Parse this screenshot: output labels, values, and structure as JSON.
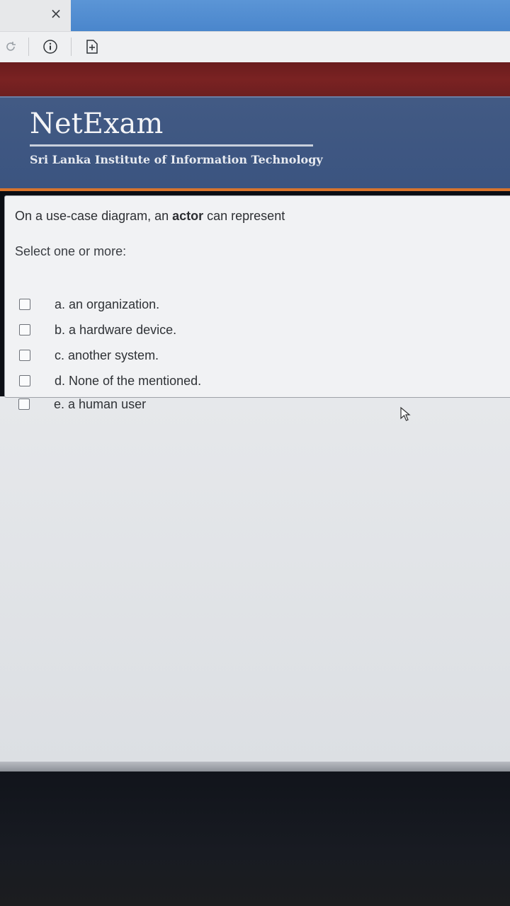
{
  "browser": {
    "close_tab_symbol": "×",
    "toolbar_icons": [
      "reload-icon",
      "info-icon",
      "add-page-icon"
    ]
  },
  "header": {
    "logo_title": "NetExam",
    "institute": "Sri Lanka Institute of Information Technology"
  },
  "question": {
    "text_before": "On a use-case diagram, an ",
    "text_bold": "actor",
    "text_after": " can represent",
    "prompt": "Select one or more:",
    "options": [
      {
        "label": "a. an organization.",
        "checked": false
      },
      {
        "label": "b. a hardware device.",
        "checked": false
      },
      {
        "label": "c. another system.",
        "checked": false
      },
      {
        "label": "d. None of the mentioned.",
        "checked": false
      },
      {
        "label": "e. a human user",
        "checked": false
      }
    ]
  },
  "colors": {
    "header_blue": "#425a84",
    "red_band": "#7a2222",
    "orange_rule": "#d8742d",
    "tab_blue": "#4a86cc"
  }
}
